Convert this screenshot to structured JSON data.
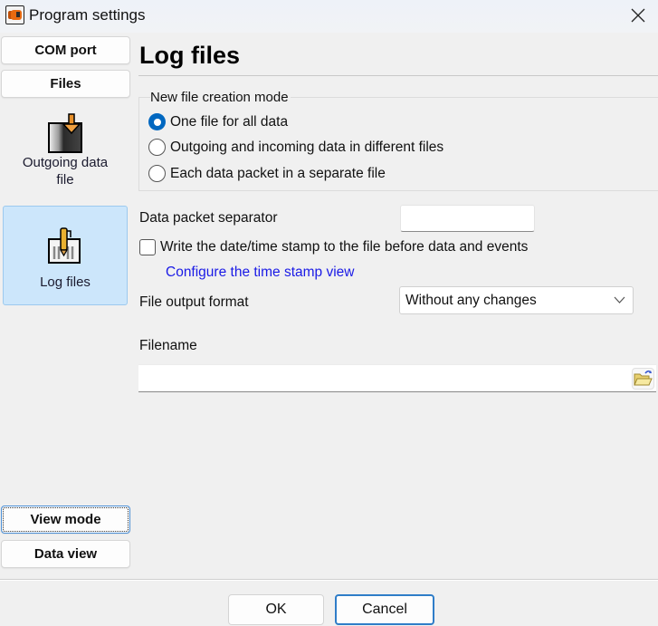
{
  "window": {
    "title": "Program settings",
    "app_icon": "com-port-icon",
    "close_icon": "close-icon"
  },
  "sidebar": {
    "top_buttons": [
      {
        "label": "COM port"
      },
      {
        "label": "Files"
      }
    ],
    "items": [
      {
        "label": "Outgoing data file",
        "icon": "outgoing-file-icon",
        "active": false
      },
      {
        "label": "Log files",
        "icon": "log-file-icon",
        "active": true
      }
    ],
    "bottom_buttons": [
      {
        "label": "View mode",
        "focused": true
      },
      {
        "label": "Data view"
      }
    ]
  },
  "main": {
    "title": "Log files",
    "creation_mode": {
      "legend": "New file creation mode",
      "options": [
        {
          "label": "One file for all data",
          "checked": true
        },
        {
          "label": "Outgoing and incoming data in different files",
          "checked": false
        },
        {
          "label": "Each data packet in a separate file",
          "checked": false
        }
      ]
    },
    "separator": {
      "label": "Data packet separator",
      "value": ""
    },
    "timestamp_checkbox": {
      "label": "Write the date/time stamp to the file before data and events",
      "checked": false
    },
    "timestamp_link": "Configure the time stamp view",
    "output_format": {
      "label": "File output format",
      "selected": "Without any changes"
    },
    "filename": {
      "label": "Filename",
      "value": "",
      "browse_icon": "folder-open-icon"
    }
  },
  "footer": {
    "ok_label": "OK",
    "cancel_label": "Cancel"
  }
}
